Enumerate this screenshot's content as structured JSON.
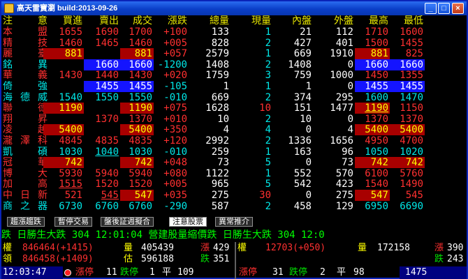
{
  "window": {
    "title": "高天雷寶瀏 build:2013-09-26",
    "btn_min": "_",
    "btn_max": "□",
    "btn_close": "×"
  },
  "header": {
    "flag": "注",
    "name": "意",
    "bid": "買進",
    "ask": "賣出",
    "last": "成交",
    "chg": "漲跌",
    "vol": "總量",
    "cur": "現量",
    "inner": "內盤",
    "outer": "外盤",
    "high": "最高",
    "low": "最低"
  },
  "rows": [
    {
      "flag": "本",
      "name": "盟",
      "bid": "1655",
      "ask": "1690",
      "last": "1700",
      "chg": "+100",
      "vol": "133",
      "cur": "1",
      "inner": "21",
      "outer": "112",
      "high": "1710",
      "low": "1600"
    },
    {
      "flag": "精",
      "name": "技",
      "bid": "1460",
      "ask": "1465",
      "last": "1460",
      "chg": "+005",
      "vol": "828",
      "cur": "2",
      "inner": "427",
      "outer": "401",
      "high": "1500",
      "low": "1455"
    },
    {
      "flag": "麗",
      "name": "臺",
      "bid": "881",
      "ask": "",
      "last": "881",
      "chg": "+057",
      "vol": "2579",
      "cur": "1",
      "inner": "669",
      "outer": "1910",
      "high": "881",
      "low": "825"
    },
    {
      "flag": "銘",
      "name": "異",
      "bid": "",
      "ask": "1660",
      "last": "1660",
      "chg": "-1200",
      "vol": "1408",
      "cur": "2",
      "inner": "1408",
      "outer": "0",
      "high": "1660",
      "low": "1660"
    },
    {
      "flag": "華",
      "name": "義",
      "bid": "1430",
      "ask": "1440",
      "last": "1430",
      "chg": "+020",
      "vol": "1759",
      "cur": "3",
      "inner": "759",
      "outer": "1000",
      "high": "1450",
      "low": "1355"
    },
    {
      "flag": "倚",
      "name": "強",
      "bid": "",
      "ask": "1455",
      "last": "1455",
      "chg": "-105",
      "vol": "1",
      "cur": "1",
      "inner": "1",
      "outer": "0",
      "high": "1455",
      "low": "1455"
    },
    {
      "flag": "海",
      "name": "德威",
      "bid": "1540",
      "ask": "1550",
      "last": "1550",
      "chg": "-010",
      "vol": "669",
      "cur": "2",
      "inner": "374",
      "outer": "295",
      "high": "1600",
      "low": "1470"
    },
    {
      "flag": "聯",
      "name": "德",
      "bid": "1190",
      "ask": "",
      "last": "1190",
      "chg": "+075",
      "vol": "1628",
      "cur": "10",
      "inner": "151",
      "outer": "1477",
      "high": "1190",
      "low": "1150"
    },
    {
      "flag": "翔",
      "name": "昇",
      "bid": "",
      "ask": "1370",
      "last": "1370",
      "chg": "+010",
      "vol": "10",
      "cur": "2",
      "inner": "10",
      "outer": "0",
      "high": "1370",
      "low": "1370"
    },
    {
      "flag": "凌",
      "name": "越",
      "bid": "5400",
      "ask": "",
      "last": "5400",
      "chg": "+350",
      "vol": "4",
      "cur": "4",
      "inner": "0",
      "outer": "4",
      "high": "5400",
      "low": "5400"
    },
    {
      "flag": "瀧",
      "name": "澤科",
      "bid": "4845",
      "ask": "4835",
      "last": "4835",
      "chg": "+120",
      "vol": "2992",
      "cur": "2",
      "inner": "1336",
      "outer": "1656",
      "high": "4950",
      "low": "4700"
    },
    {
      "flag": "凱",
      "name": "碩",
      "bid": "1030",
      "ask": "1040",
      "last": "1030",
      "chg": "-010",
      "vol": "259",
      "cur": "1",
      "inner": "163",
      "outer": "96",
      "high": "1050",
      "low": "1020"
    },
    {
      "flag": "冠",
      "name": "華",
      "bid": "742",
      "ask": "",
      "last": "742",
      "chg": "+048",
      "vol": "73",
      "cur": "5",
      "inner": "0",
      "outer": "73",
      "high": "742",
      "low": "742"
    },
    {
      "flag": "博",
      "name": "大",
      "bid": "5930",
      "ask": "5940",
      "last": "5940",
      "chg": "+080",
      "vol": "1122",
      "cur": "1",
      "inner": "552",
      "outer": "570",
      "high": "6100",
      "low": "5760"
    },
    {
      "flag": "加",
      "name": "高",
      "bid": "1515",
      "ask": "1520",
      "last": "1520",
      "chg": "+005",
      "vol": "965",
      "cur": "5",
      "inner": "542",
      "outer": "423",
      "high": "1540",
      "low": "1490"
    },
    {
      "flag": "中",
      "name": "日新",
      "bid": "521",
      "ask": "545",
      "last": "547",
      "chg": "+035",
      "vol": "275",
      "cur": "30",
      "inner": "0",
      "outer": "275",
      "high": "547",
      "low": "545"
    },
    {
      "flag": "商",
      "name": "之器",
      "bid": "6730",
      "ask": "6760",
      "last": "6760",
      "chg": "-290",
      "vol": "587",
      "cur": "2",
      "inner": "458",
      "outer": "129",
      "high": "6950",
      "low": "6690"
    }
  ],
  "tabs": [
    "趨漲趨跌",
    "暫停交易",
    "盤後証週擬合",
    "注意股票",
    "異常推介"
  ],
  "ticker": "跌 日勝生大跌  304 12:01:04 營建股量縮價跌 日勝生大跌  304 12:0",
  "market": {
    "row1": {
      "label_a": "權",
      "val_a": "846464(+1415)",
      "label_b": "量",
      "val_b": "405439",
      "label_c": "漲",
      "val_c": "429",
      "label_d": "權",
      "val_d": "12703(+050)",
      "label_e": "量",
      "val_e": "172158",
      "label_f": "漲",
      "val_f": "390"
    },
    "row2": {
      "label_a": "領",
      "val_a": "846458(+1409)",
      "label_b": "估",
      "val_b": "596188",
      "label_c": "跌",
      "val_c": "351",
      "label_f": "跌",
      "val_f": "243"
    }
  },
  "status": {
    "time": "12:03:47",
    "limit_up_label": "漲停",
    "limit_up": "11",
    "limit_down_label": "跌停",
    "limit_down": "1",
    "flat_label": "平",
    "flat": "109",
    "r_limit_up_label": "漲停",
    "r_limit_up": "31",
    "r_limit_down_label": "跌停",
    "r_limit_down": "2",
    "r_flat_label": "平",
    "r_flat": "98",
    "r_total": "1475"
  }
}
